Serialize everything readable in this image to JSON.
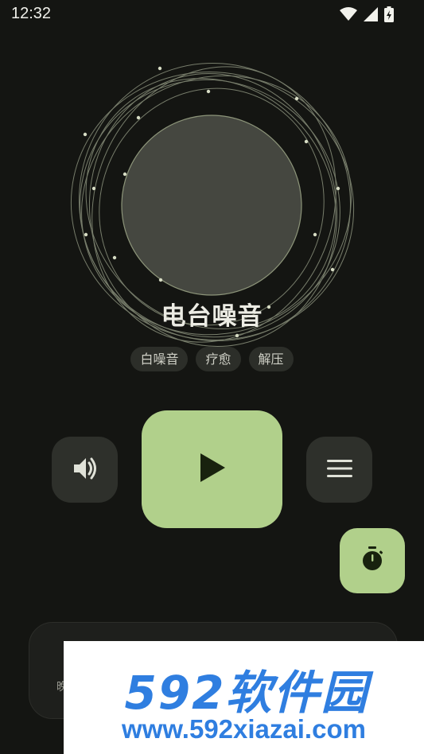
{
  "status_bar": {
    "time": "12:32",
    "icons": [
      "wifi-icon",
      "signal-icon",
      "battery-charging-icon"
    ]
  },
  "player": {
    "title": "电台噪音",
    "tags": [
      "白噪音",
      "疗愈",
      "解压"
    ],
    "playing": false
  },
  "controls": {
    "volume_icon": "volume-icon",
    "play_icon": "play-icon",
    "playlist_icon": "menu-icon",
    "timer_icon": "stopwatch-icon"
  },
  "bottom_card": {
    "text": "晚"
  },
  "watermark": {
    "brand": "592软件园",
    "url": "www.592xiazai.com"
  },
  "colors": {
    "background": "#141512",
    "accent": "#b1d08b",
    "orb": "#454740",
    "button_dark": "#2e302b",
    "watermark_blue": "#2f7ee0"
  }
}
